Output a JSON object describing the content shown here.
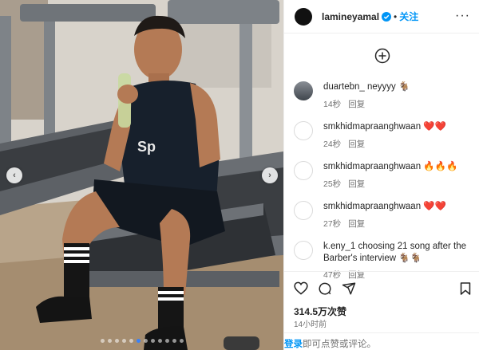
{
  "post": {
    "username": "lamineyamal",
    "separator": "•",
    "follow_label": "关注",
    "more_label": "···",
    "likes": "314.5万次赞",
    "time": "14小时前",
    "footer": {
      "login": "登录",
      "rest": "即可点赞或评论。"
    }
  },
  "media": {
    "jersey_text": "Sp",
    "slide_count": 12,
    "active_slide": 5
  },
  "comments": [
    {
      "username": "duartebn_",
      "text": "neyyyy 🐐",
      "time": "14秒",
      "reply": "回复",
      "avatar": "photo"
    },
    {
      "username": "smkhidmapraanghwaan",
      "text": "❤️❤️",
      "time": "24秒",
      "reply": "回复",
      "avatar": "default"
    },
    {
      "username": "smkhidmapraanghwaan",
      "text": "🔥🔥🔥",
      "time": "25秒",
      "reply": "回复",
      "avatar": "default"
    },
    {
      "username": "smkhidmapraanghwaan",
      "text": "❤️❤️",
      "time": "27秒",
      "reply": "回复",
      "avatar": "default"
    },
    {
      "username": "k.eny_1",
      "text": "choosing 21 song after the Barber's interview 🐐🐐",
      "time": "47秒",
      "reply": "回复",
      "avatar": "default"
    }
  ],
  "colors": {
    "accent": "#0095f6",
    "secondary_text": "#737373",
    "verified": "#0095f6"
  }
}
